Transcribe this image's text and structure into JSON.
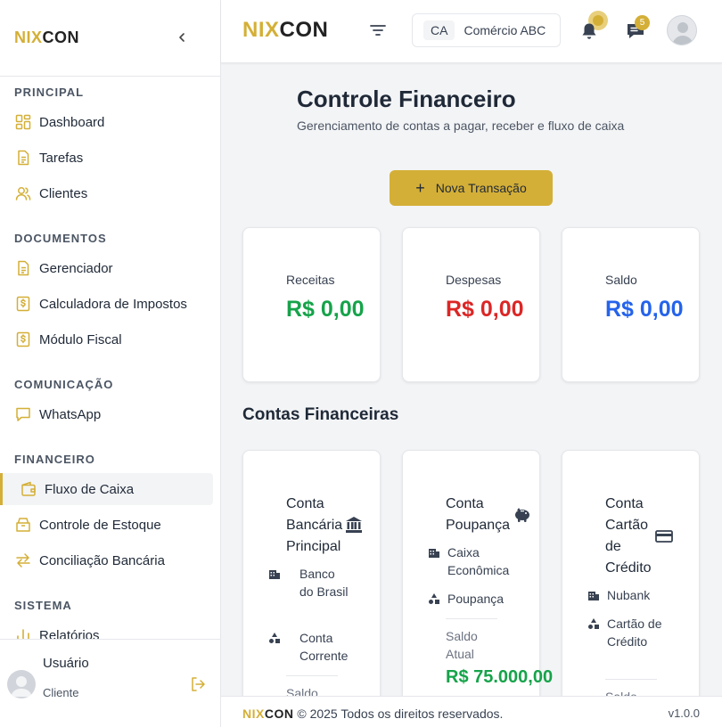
{
  "brand": {
    "part1": "NIX",
    "part2": "CON",
    "accent": "#d4af37"
  },
  "sidebar": {
    "collapse_icon": "chevron-left-icon",
    "sections": [
      {
        "label": "PRINCIPAL",
        "items": [
          {
            "label": "Dashboard",
            "icon": "grid-icon"
          },
          {
            "label": "Tarefas",
            "icon": "document-icon"
          },
          {
            "label": "Clientes",
            "icon": "users-icon"
          }
        ]
      },
      {
        "label": "DOCUMENTOS",
        "items": [
          {
            "label": "Gerenciador",
            "icon": "document-icon"
          },
          {
            "label": "Calculadora de Impostos",
            "icon": "dollar-document-icon"
          },
          {
            "label": "Módulo Fiscal",
            "icon": "dollar-document-icon"
          }
        ]
      },
      {
        "label": "COMUNICAÇÃO",
        "items": [
          {
            "label": "WhatsApp",
            "icon": "chat-icon"
          }
        ]
      },
      {
        "label": "FINANCEIRO",
        "items": [
          {
            "label": "Fluxo de Caixa",
            "icon": "wallet-icon",
            "active": true
          },
          {
            "label": "Controle de Estoque",
            "icon": "box-icon"
          },
          {
            "label": "Conciliação Bancária",
            "icon": "swap-icon"
          }
        ]
      },
      {
        "label": "SISTEMA",
        "items": [
          {
            "label": "Relatórios",
            "icon": "bar-chart-icon"
          }
        ]
      }
    ],
    "user": {
      "name": "Usuário",
      "role": "Cliente"
    }
  },
  "header": {
    "company_abbr": "CA",
    "company_name": "Comércio ABC",
    "chat_count": "5"
  },
  "main": {
    "title": "Controle Financeiro",
    "subtitle": "Gerenciamento de contas a pagar, receber e fluxo de caixa",
    "new_button": {
      "icon": "+",
      "label": "Nova Transação"
    },
    "stats": [
      {
        "label": "Receitas",
        "value": "R$ 0,00",
        "color": "#16a34a"
      },
      {
        "label": "Despesas",
        "value": "R$ 0,00",
        "color": "#dc2626"
      },
      {
        "label": "Saldo",
        "value": "R$ 0,00",
        "color": "#2563eb"
      }
    ],
    "accounts_title": "Contas Financeiras",
    "accounts": [
      {
        "name": "Conta Bancária Principal",
        "icon": "bank-icon",
        "bank": "Banco do Brasil",
        "type": "Conta Corrente",
        "balance_label": "Saldo"
      },
      {
        "name": "Conta Poupança",
        "icon": "piggy-bank-icon",
        "bank": "Caixa Econômica",
        "type": "Poupança",
        "balance_label": "Saldo Atual",
        "balance": "R$ 75.000,00"
      },
      {
        "name": "Conta Cartão de Crédito",
        "icon": "credit-card-icon",
        "bank": "Nubank",
        "type": "Cartão de Crédito",
        "balance_label": "Saldo"
      }
    ]
  },
  "footer": {
    "text": "© 2025 Todos os direitos reservados.",
    "version": "v1.0.0"
  }
}
